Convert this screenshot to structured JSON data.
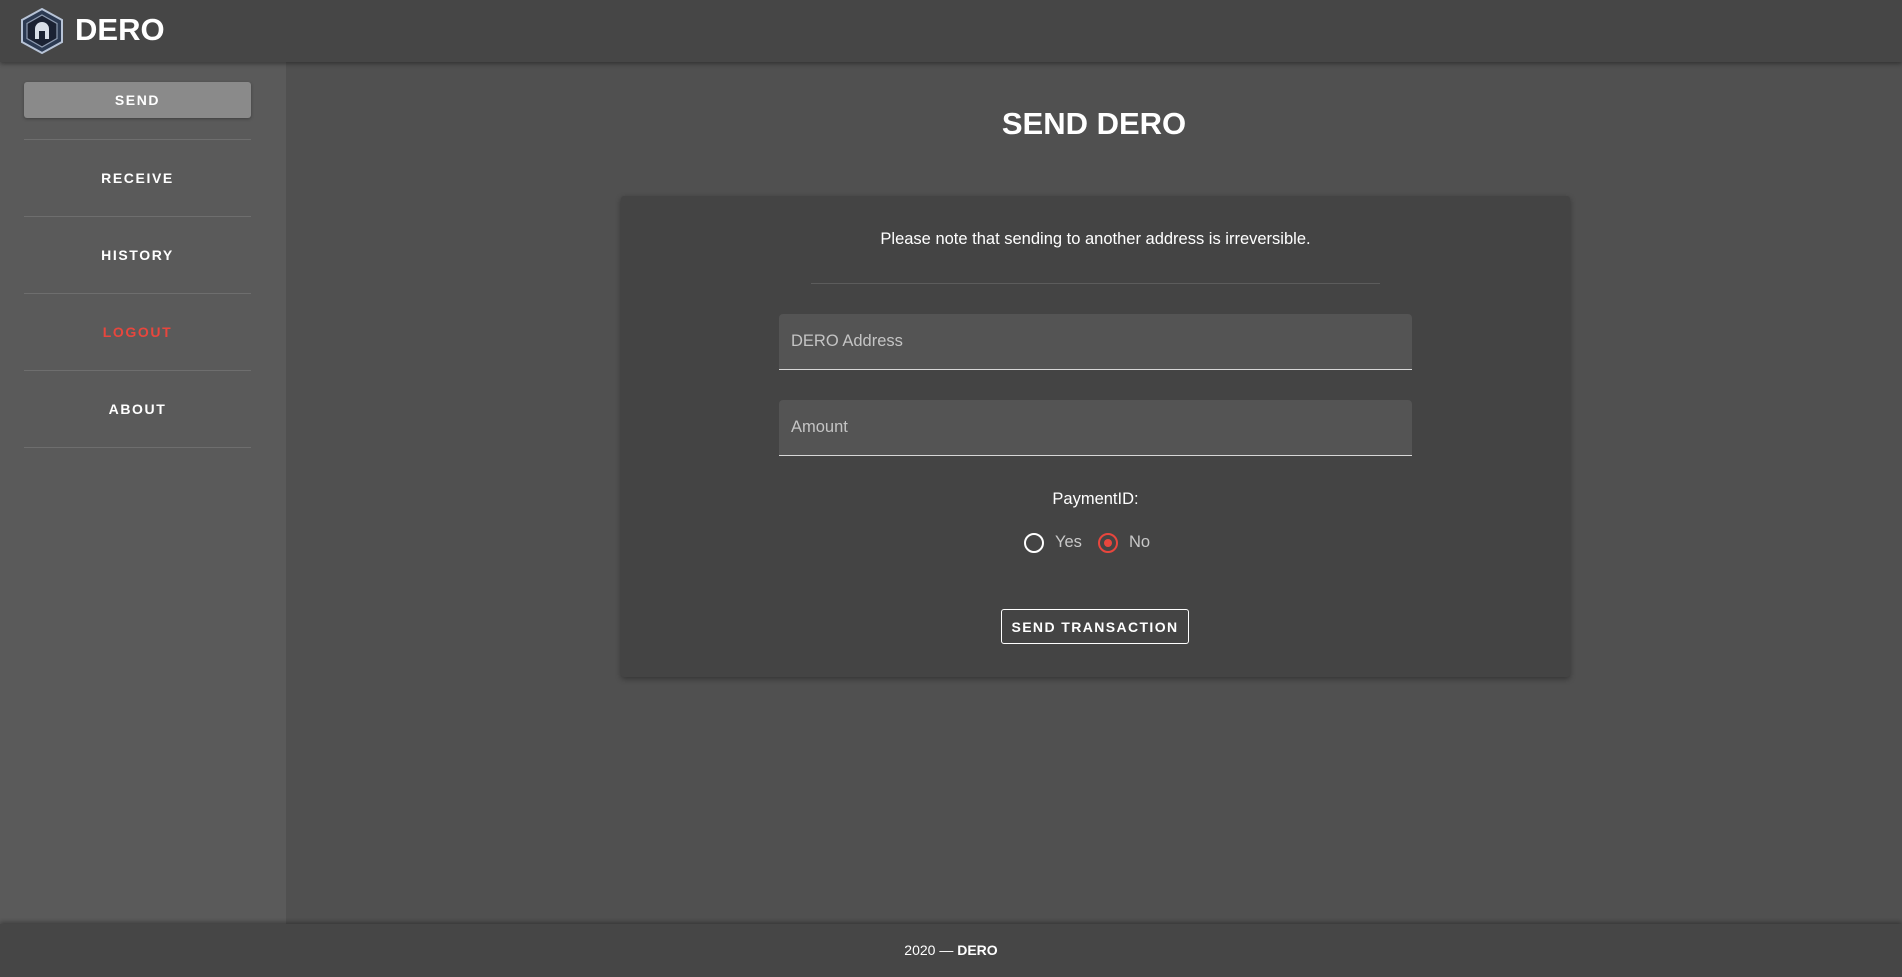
{
  "app": {
    "brand": "DERO",
    "logo_icon": "dero-logo-icon"
  },
  "sidebar": {
    "items": [
      {
        "label": "SEND",
        "active": true
      },
      {
        "label": "RECEIVE"
      },
      {
        "label": "HISTORY"
      },
      {
        "label": "LOGOUT",
        "color": "#e8463d"
      },
      {
        "label": "ABOUT"
      }
    ]
  },
  "main": {
    "title": "SEND DERO",
    "notice": "Please note that sending to another address is irreversible.",
    "address_placeholder": "DERO Address",
    "address_value": "",
    "amount_placeholder": "Amount",
    "amount_value": "",
    "payment_id_label": "PaymentID:",
    "payment_id_options": [
      {
        "label": "Yes",
        "selected": false
      },
      {
        "label": "No",
        "selected": true
      }
    ],
    "send_button": "SEND TRANSACTION"
  },
  "footer": {
    "year": "2020 —",
    "brand": "DERO"
  },
  "colors": {
    "accent": "#e8463d",
    "background": "#505050",
    "sidebar": "#5a5a5a",
    "card": "#444444",
    "topbar": "#464646"
  }
}
